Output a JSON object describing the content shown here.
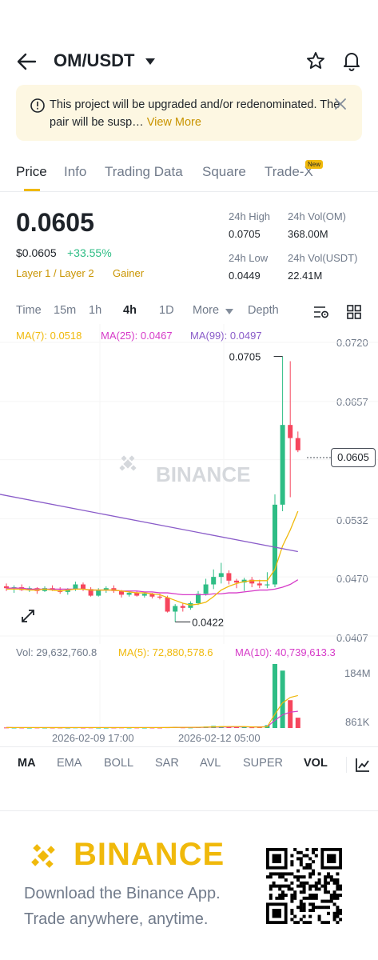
{
  "header": {
    "pair": "OM/USDT"
  },
  "notice": {
    "text": "This project will be upgraded and/or redenominated. The pair will be susp…",
    "link": "View More"
  },
  "tabs": [
    {
      "label": "Price",
      "active": true
    },
    {
      "label": "Info"
    },
    {
      "label": "Trading Data"
    },
    {
      "label": "Square"
    },
    {
      "label": "Trade-X",
      "badge": "New"
    }
  ],
  "ticker": {
    "last_price": "0.0605",
    "usd_price": "$0.0605",
    "change": "+33.55%",
    "tags": [
      "Layer 1 / Layer 2",
      "Gainer"
    ],
    "stats": {
      "high_label": "24h High",
      "high": "0.0705",
      "vol_om_label": "24h Vol(OM)",
      "vol_om": "368.00M",
      "low_label": "24h Low",
      "low": "0.0449",
      "vol_usdt_label": "24h Vol(USDT)",
      "vol_usdt": "22.41M"
    }
  },
  "intervals": [
    "Time",
    "15m",
    "1h",
    "4h",
    "1D",
    "More",
    "Depth"
  ],
  "active_interval": "4h",
  "ma": {
    "ma7": "MA(7): 0.0518",
    "ma25": "MA(25): 0.0467",
    "ma99": "MA(99): 0.0497"
  },
  "chart_watermark": "BINANCE",
  "price_axis": [
    "0.0720",
    "0.0657",
    "0.0532",
    "0.0470",
    "0.0407"
  ],
  "current_price_tag": "0.0605",
  "high_marker": "0.0705",
  "low_marker": "0.0422",
  "volume": {
    "vol": "Vol: 29,632,760.8",
    "ma5": "MA(5): 72,880,578.6",
    "ma10": "MA(10): 40,739,613.3",
    "axis_top": "184M",
    "axis_bottom": "861K"
  },
  "time_axis": [
    "2026-02-09 17:00",
    "2026-02-12 05:00"
  ],
  "indicators": [
    "MA",
    "EMA",
    "BOLL",
    "SAR",
    "AVL",
    "SUPER",
    "VOL"
  ],
  "active_indicators": [
    "MA",
    "VOL"
  ],
  "promo": {
    "brand": "BINANCE",
    "line1": "Download the Binance App.",
    "line2": "Trade anywhere, anytime."
  },
  "colors": {
    "up": "#2ebd85",
    "down": "#f6465d",
    "brand": "#f0b90b",
    "ma7": "#f0b90b",
    "ma25": "#d63bc8",
    "ma99": "#8a5cc9"
  },
  "chart_data": {
    "type": "candlestick",
    "y_range": [
      0.0407,
      0.072
    ],
    "x_labels": [
      "2026-02-09 17:00",
      "2026-02-12 05:00"
    ],
    "candles": [
      [
        0.046,
        0.0463,
        0.0455,
        0.0458
      ],
      [
        0.0458,
        0.0461,
        0.0453,
        0.0459
      ],
      [
        0.0459,
        0.0462,
        0.0455,
        0.0456
      ],
      [
        0.0456,
        0.046,
        0.0454,
        0.0458
      ],
      [
        0.0458,
        0.0459,
        0.0452,
        0.0455
      ],
      [
        0.0455,
        0.046,
        0.0454,
        0.0458
      ],
      [
        0.0458,
        0.0461,
        0.0455,
        0.0456
      ],
      [
        0.0456,
        0.0459,
        0.0452,
        0.0454
      ],
      [
        0.0454,
        0.0458,
        0.0451,
        0.0457
      ],
      [
        0.0457,
        0.0465,
        0.0455,
        0.0462
      ],
      [
        0.0462,
        0.0464,
        0.0455,
        0.0457
      ],
      [
        0.0457,
        0.0459,
        0.0449,
        0.045
      ],
      [
        0.045,
        0.0458,
        0.0449,
        0.0456
      ],
      [
        0.0456,
        0.046,
        0.0453,
        0.0458
      ],
      [
        0.0458,
        0.0461,
        0.0453,
        0.0455
      ],
      [
        0.0455,
        0.0456,
        0.0448,
        0.0451
      ],
      [
        0.0451,
        0.0455,
        0.0449,
        0.0453
      ],
      [
        0.0453,
        0.0455,
        0.0449,
        0.045
      ],
      [
        0.045,
        0.0453,
        0.0448,
        0.0452
      ],
      [
        0.0452,
        0.0453,
        0.0447,
        0.0449
      ],
      [
        0.0449,
        0.0452,
        0.0446,
        0.0448
      ],
      [
        0.0448,
        0.045,
        0.0432,
        0.0433
      ],
      [
        0.0433,
        0.0441,
        0.0422,
        0.0439
      ],
      [
        0.0439,
        0.0442,
        0.0433,
        0.0437
      ],
      [
        0.0437,
        0.0444,
        0.0435,
        0.0442
      ],
      [
        0.0442,
        0.0455,
        0.044,
        0.0452
      ],
      [
        0.0452,
        0.0468,
        0.045,
        0.0462
      ],
      [
        0.0462,
        0.0478,
        0.0457,
        0.047
      ],
      [
        0.047,
        0.0485,
        0.0463,
        0.0474
      ],
      [
        0.0474,
        0.0477,
        0.0462,
        0.0466
      ],
      [
        0.0466,
        0.0468,
        0.0458,
        0.0464
      ],
      [
        0.0464,
        0.0469,
        0.0455,
        0.0467
      ],
      [
        0.0467,
        0.047,
        0.0459,
        0.0463
      ],
      [
        0.0463,
        0.0467,
        0.0458,
        0.0461
      ],
      [
        0.0461,
        0.0475,
        0.0458,
        0.0462
      ],
      [
        0.0462,
        0.0558,
        0.0459,
        0.0547
      ],
      [
        0.0547,
        0.0705,
        0.054,
        0.0632
      ],
      [
        0.0632,
        0.07,
        0.0555,
        0.0618
      ],
      [
        0.0618,
        0.0625,
        0.0603,
        0.0605
      ]
    ],
    "volume_range": [
      0,
      184000000
    ],
    "volumes": [
      1500000.0,
      1200000.0,
      1300000.0,
      1000000.0,
      1400000.0,
      1100000.0,
      1200000.0,
      1300000.0,
      1000000.0,
      1600000.0,
      1200000.0,
      1500000.0,
      1100000.0,
      1000000.0,
      1300000.0,
      1600000.0,
      1200000.0,
      1400000.0,
      1100000.0,
      1300000.0,
      1200000.0,
      2000000.0,
      3000000.0,
      1800000.0,
      1500000.0,
      2500000.0,
      4000000.0,
      6000000.0,
      5000000.0,
      3500000.0,
      2500000.0,
      3000000.0,
      2000000.0,
      2200000.0,
      8000000.0,
      184000000.0,
      165000000.0,
      80000000.0,
      29600000.0
    ],
    "ma7": [
      0.0457,
      0.0457,
      0.0457,
      0.0456,
      0.0456,
      0.0457,
      0.0456,
      0.0455,
      0.0456,
      0.0457,
      0.0457,
      0.0456,
      0.0456,
      0.0456,
      0.0456,
      0.0455,
      0.0454,
      0.0453,
      0.0453,
      0.0452,
      0.0451,
      0.0448,
      0.0445,
      0.0442,
      0.044,
      0.0441,
      0.0443,
      0.0449,
      0.0456,
      0.046,
      0.0463,
      0.0465,
      0.0466,
      0.0466,
      0.0466,
      0.0478,
      0.0503,
      0.052,
      0.054
    ],
    "ma25": [
      0.0458,
      0.0458,
      0.0458,
      0.0457,
      0.0457,
      0.0457,
      0.0457,
      0.0457,
      0.0457,
      0.0457,
      0.0457,
      0.0456,
      0.0456,
      0.0456,
      0.0456,
      0.0455,
      0.0455,
      0.0455,
      0.0454,
      0.0454,
      0.0453,
      0.0453,
      0.0452,
      0.0451,
      0.0451,
      0.0451,
      0.0451,
      0.0452,
      0.0452,
      0.0453,
      0.0453,
      0.0454,
      0.0455,
      0.0456,
      0.0456,
      0.0457,
      0.0459,
      0.0462,
      0.0467
    ],
    "ma99_start": 0.0558,
    "ma99_end": 0.0497
  }
}
